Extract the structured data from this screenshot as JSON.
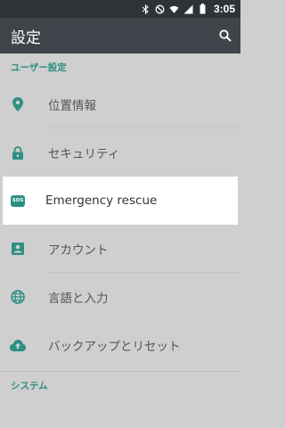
{
  "status_bar": {
    "time": "3:05",
    "icons": [
      "bluetooth-icon",
      "do-not-disturb-icon",
      "wifi-icon",
      "signal-icon",
      "battery-icon"
    ]
  },
  "toolbar": {
    "title": "設定",
    "search_icon": "search-icon"
  },
  "sections": [
    {
      "header": "ユーザー設定",
      "items": [
        {
          "label": "位置情報",
          "icon": "location-icon"
        },
        {
          "label": "セキュリティ",
          "icon": "lock-icon"
        },
        {
          "label": "Emergency rescue",
          "icon": "sos-icon",
          "icon_text": "SOS"
        },
        {
          "label": "アカウント",
          "icon": "account-icon"
        },
        {
          "label": "言語と入力",
          "icon": "globe-icon"
        },
        {
          "label": "バックアップとリセット",
          "icon": "cloud-upload-icon"
        }
      ]
    },
    {
      "header": "システム",
      "items": []
    }
  ],
  "colors": {
    "accent": "#2e8f83",
    "toolbar": "#3e4449",
    "status_bar": "#2f3336",
    "background": "#cfcfcf",
    "highlight": "#ffffff"
  }
}
